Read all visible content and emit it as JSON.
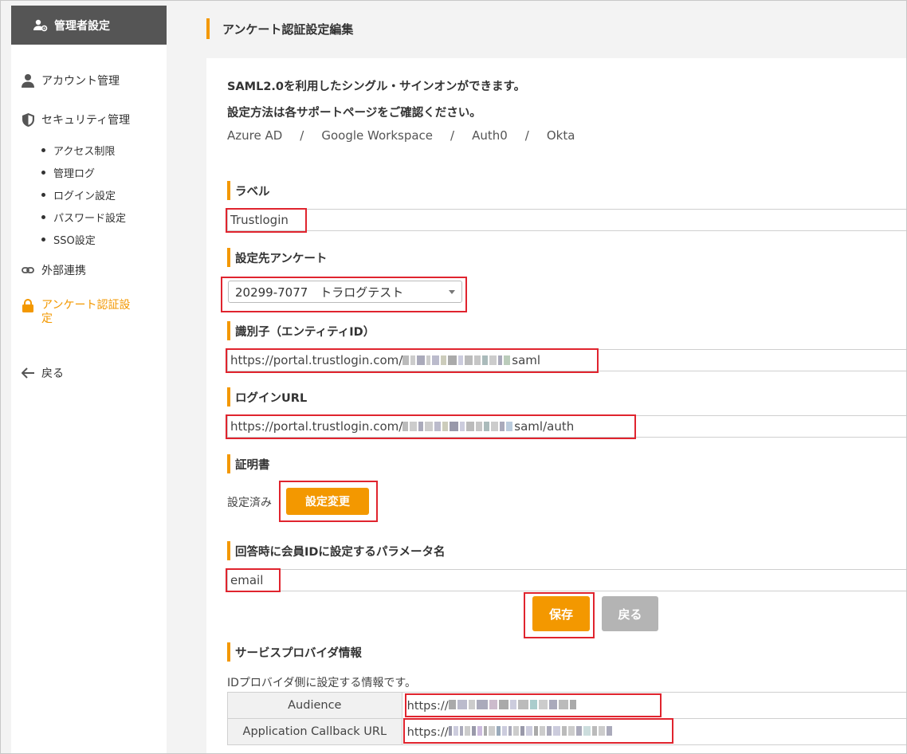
{
  "sidebar": {
    "header": "管理者設定",
    "items": [
      {
        "label": "アカウント管理",
        "icon": "person-icon"
      },
      {
        "label": "セキュリティ管理",
        "icon": "shield-icon"
      },
      {
        "label": "外部連携",
        "icon": "link-icon"
      },
      {
        "label": "アンケート認証設定",
        "icon": "lock-icon"
      },
      {
        "label": "戻る",
        "icon": "arrow-left-icon"
      }
    ],
    "security_sub": [
      "アクセス制限",
      "管理ログ",
      "ログイン設定",
      "パスワード設定",
      "SSO設定"
    ]
  },
  "header": {
    "title": "アンケート認証設定編集"
  },
  "intro": {
    "line1": "SAML2.0を利用したシングル・サインオンができます。",
    "line2": "設定方法は各サポートページをご確認ください。",
    "links": [
      "Azure AD",
      "Google Workspace",
      "Auth0",
      "Okta"
    ],
    "separator": "/"
  },
  "form": {
    "label": {
      "title": "ラベル",
      "value": "Trustlogin"
    },
    "survey": {
      "title": "設定先アンケート",
      "selected": "20299-7077　トラログテスト"
    },
    "entity_id": {
      "title": "識別子（エンティティID）",
      "prefix": "https://portal.trustlogin.com/",
      "suffix": "saml"
    },
    "login_url": {
      "title": "ログインURL",
      "prefix": "https://portal.trustlogin.com/",
      "suffix": "saml/auth"
    },
    "certificate": {
      "title": "証明書",
      "status": "設定済み",
      "button": "設定変更"
    },
    "member_id": {
      "title": "回答時に会員IDに設定するパラメータ名",
      "value": "email"
    },
    "save_button": "保存",
    "back_button": "戻る"
  },
  "service_provider": {
    "title": "サービスプロバイダ情報",
    "description": "IDプロバイダ側に設定する情報です。",
    "rows": [
      {
        "name": "Audience",
        "prefix": "https://"
      },
      {
        "name": "Application Callback URL",
        "prefix": "https://"
      }
    ]
  },
  "colors": {
    "accent": "#f39800",
    "highlight": "#e0242e",
    "sidebar_header": "#555555"
  }
}
